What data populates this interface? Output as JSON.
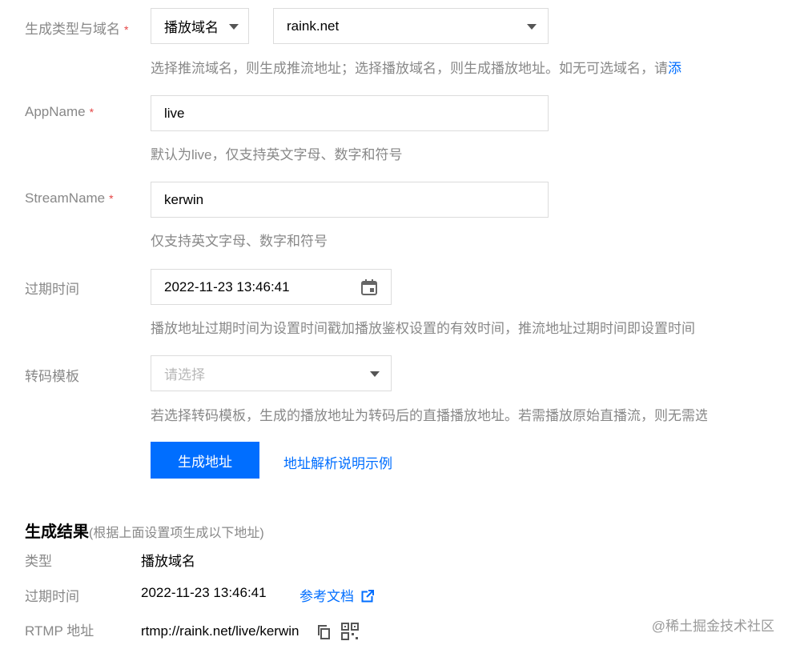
{
  "form": {
    "domain": {
      "label": "生成类型与域名",
      "required": "*",
      "type_value": "播放域名",
      "domain_value": "raink.net",
      "hint": "选择推流域名，则生成推流地址；选择播放域名，则生成播放地址。如无可选域名，请",
      "hint_link": "添"
    },
    "app_name": {
      "label": "AppName",
      "required": "*",
      "value": "live",
      "hint": "默认为live，仅支持英文字母、数字和符号"
    },
    "stream_name": {
      "label": "StreamName",
      "required": "*",
      "value": "kerwin",
      "hint": "仅支持英文字母、数字和符号"
    },
    "expire": {
      "label": "过期时间",
      "value": "2022-11-23 13:46:41",
      "hint": "播放地址过期时间为设置时间戳加播放鉴权设置的有效时间，推流地址过期时间即设置时间"
    },
    "transcode": {
      "label": "转码模板",
      "placeholder": "请选择",
      "hint": "若选择转码模板，生成的播放地址为转码后的直播播放地址。若需播放原始直播流，则无需选择"
    },
    "generate_button": "生成地址",
    "help_link": "地址解析说明示例"
  },
  "result": {
    "title": "生成结果",
    "subtitle": "(根据上面设置项生成以下地址)",
    "rows": {
      "type_label": "类型",
      "type_value": "播放域名",
      "expire_label": "过期时间",
      "expire_value": "2022-11-23 13:46:41",
      "doc_link": "参考文档",
      "rtmp_label": "RTMP 地址",
      "rtmp_value": "rtmp://raink.net/live/kerwin"
    }
  },
  "watermark": "@稀土掘金技术社区",
  "colors": {
    "accent": "#006eff",
    "required": "#e54545",
    "muted": "#888888",
    "border": "#dcdcdc"
  }
}
